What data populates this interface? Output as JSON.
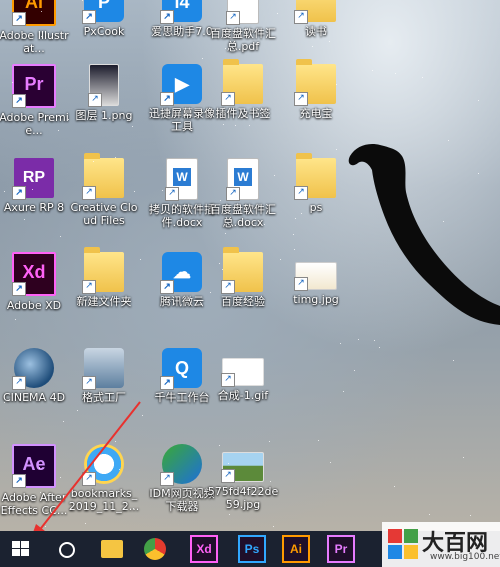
{
  "desktop": {
    "rows": [
      [
        {
          "icon": "adobe-illustrator-icon",
          "label": "Adobe Illustrat...",
          "kind": "ai-logo",
          "text": "Ai"
        },
        {
          "icon": "pxcook-icon",
          "label": "PxCook",
          "kind": "blue-app",
          "text": "P"
        },
        {
          "icon": "aisi-helper-icon",
          "label": "爱思助手7.0",
          "kind": "blue-app",
          "text": "i4"
        },
        {
          "icon": "pdf-file-icon",
          "label": "百度盘软件汇总.pdf",
          "kind": "doc",
          "text": ""
        },
        {
          "icon": "folder-icon",
          "label": "读书",
          "kind": "folder",
          "text": ""
        }
      ],
      [
        {
          "icon": "adobe-premiere-icon",
          "label": "Adobe Premie...",
          "kind": "pr-logo",
          "text": "Pr"
        },
        {
          "icon": "image-file-icon",
          "label": "图层 1.png",
          "kind": "photo",
          "text": ""
        },
        {
          "icon": "screen-recorder-icon",
          "label": "迅捷屏幕录像工具",
          "kind": "blue-app",
          "text": "▶"
        },
        {
          "icon": "folder-icon",
          "label": "插件及书签",
          "kind": "folder",
          "text": ""
        },
        {
          "icon": "folder-icon",
          "label": "充电宝",
          "kind": "folder",
          "text": ""
        }
      ],
      [
        {
          "icon": "axure-rp-icon",
          "label": "Axure RP 8",
          "kind": "rp-logo",
          "text": "RP"
        },
        {
          "icon": "creative-cloud-folder-icon",
          "label": "Creative Cloud Files",
          "kind": "folder",
          "text": ""
        },
        {
          "icon": "word-doc-icon",
          "label": "拷贝的软件插件.docx",
          "kind": "doc-w",
          "text": "W"
        },
        {
          "icon": "word-doc-icon",
          "label": "百度盘软件汇总.docx",
          "kind": "doc-w",
          "text": "W"
        },
        {
          "icon": "folder-icon",
          "label": "ps",
          "kind": "folder",
          "text": ""
        }
      ],
      [
        {
          "icon": "adobe-xd-icon",
          "label": "Adobe XD",
          "kind": "xd-logo",
          "text": "Xd"
        },
        {
          "icon": "folder-icon",
          "label": "新建文件夹",
          "kind": "folder",
          "text": ""
        },
        {
          "icon": "tencent-weiyun-icon",
          "label": "腾讯微云",
          "kind": "blue-app",
          "text": "☁"
        },
        {
          "icon": "folder-icon",
          "label": "百度经验",
          "kind": "folder",
          "text": ""
        },
        {
          "icon": "image-file-icon",
          "label": "timg.jpg",
          "kind": "png-book",
          "text": ""
        }
      ],
      [
        {
          "icon": "cinema-4d-icon",
          "label": "CINEMA 4D",
          "kind": "c4d",
          "text": ""
        },
        {
          "icon": "format-factory-icon",
          "label": "格式工厂",
          "kind": "factory",
          "text": ""
        },
        {
          "icon": "qianniu-icon",
          "label": "千牛工作台",
          "kind": "qn",
          "text": "Q"
        },
        {
          "icon": "gif-file-icon",
          "label": "合成-1.gif",
          "kind": "gif",
          "text": ""
        }
      ],
      [
        {
          "icon": "adobe-after-effects-icon",
          "label": "Adobe After Effects CC...",
          "kind": "ae-logo",
          "text": "Ae"
        },
        {
          "icon": "html-file-icon",
          "label": "bookmarks_2019_11_2...",
          "kind": "ie",
          "text": ""
        },
        {
          "icon": "idm-icon",
          "label": "IDM网页视频下载器",
          "kind": "idm",
          "text": ""
        },
        {
          "icon": "image-file-icon",
          "label": "575fd4f22de59.jpg",
          "kind": "landscape",
          "text": ""
        }
      ]
    ]
  },
  "taskbar": {
    "items": [
      {
        "name": "file-explorer-icon",
        "text": "",
        "color": "#f5c542"
      },
      {
        "name": "chrome-icon",
        "text": "",
        "color": "#e33b2e"
      },
      {
        "name": "adobe-xd-icon",
        "text": "Xd",
        "color": "#ff61f6"
      },
      {
        "name": "photoshop-icon",
        "text": "Ps",
        "color": "#31a8ff"
      },
      {
        "name": "illustrator-icon",
        "text": "Ai",
        "color": "#ff9a00"
      },
      {
        "name": "premiere-icon",
        "text": "Pr",
        "color": "#e77cff"
      }
    ]
  },
  "watermark": {
    "name": "大百网",
    "url": "www.big100.net"
  },
  "colors": {
    "taskbar": "#1b2230",
    "arrow": "#e8312e"
  }
}
